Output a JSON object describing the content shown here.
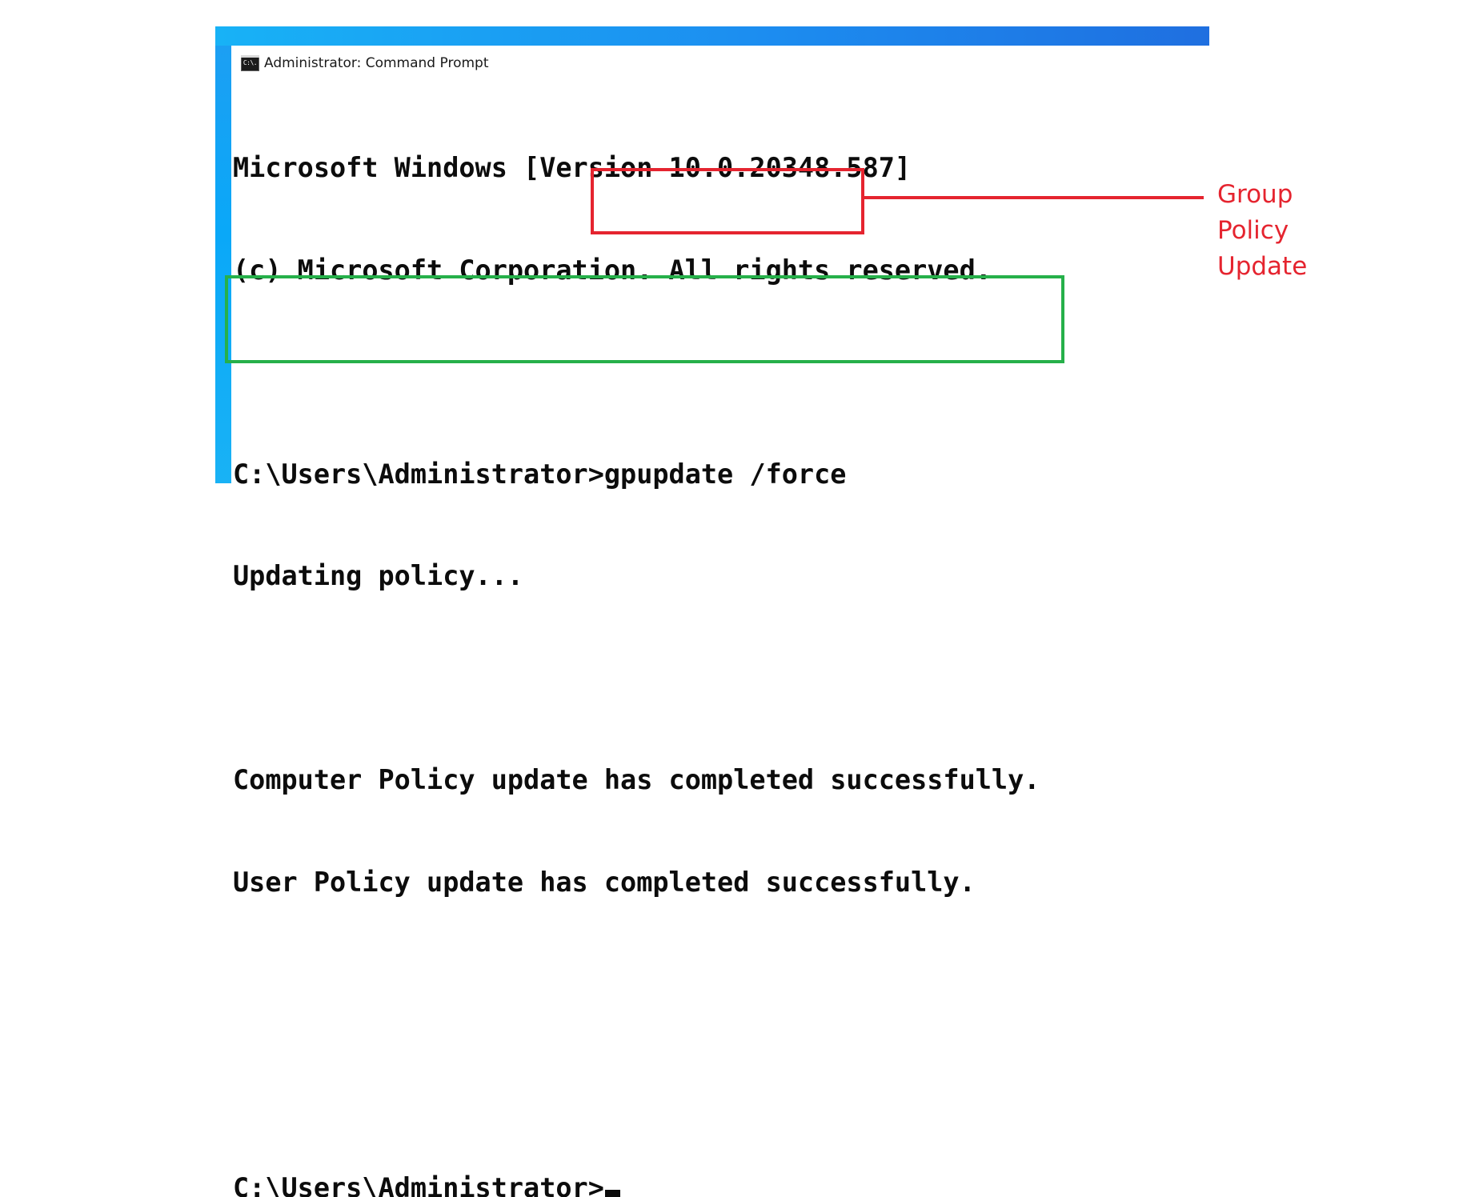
{
  "window": {
    "title": "Administrator: Command Prompt",
    "icon": "command-prompt-icon",
    "icon_glyph": "C:\\."
  },
  "terminal": {
    "lines": [
      "Microsoft Windows [Version 10.0.20348.587]",
      "(c) Microsoft Corporation. All rights reserved.",
      "",
      "C:\\Users\\Administrator>gpupdate /force",
      "Updating policy...",
      "",
      "Computer Policy update has completed successfully.",
      "User Policy update has completed successfully.",
      "",
      "",
      "C:\\Users\\Administrator>"
    ]
  },
  "annotation": {
    "lines": [
      "Group",
      "Policy",
      "Update"
    ],
    "color": "#e5242f"
  },
  "highlight_colors": {
    "command": "#e5242f",
    "result": "#26b04a"
  }
}
